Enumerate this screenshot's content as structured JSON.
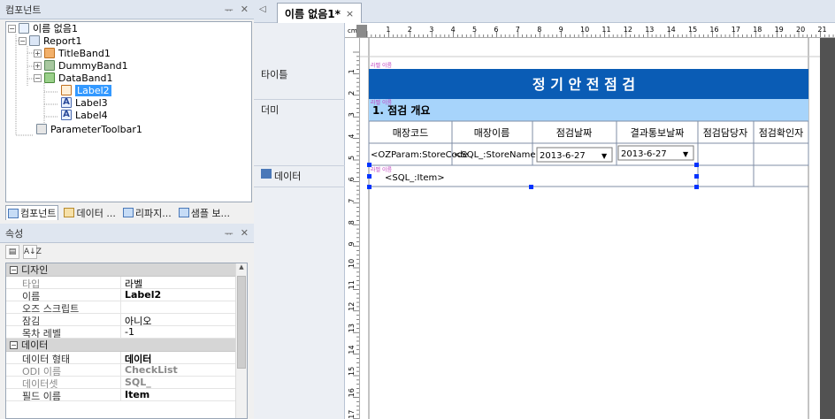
{
  "components_panel": {
    "title": "컴포넌트",
    "pin": "ᅲ",
    "close": "✕",
    "tree": [
      {
        "label": "이름 없음1",
        "depth": 0,
        "icon": "form-icon",
        "toggle": "-"
      },
      {
        "label": "Report1",
        "depth": 1,
        "icon": "report-icon",
        "toggle": "-"
      },
      {
        "label": "TitleBand1",
        "depth": 2,
        "icon": "title-band-icon",
        "toggle": "+"
      },
      {
        "label": "DummyBand1",
        "depth": 2,
        "icon": "dummy-band-icon",
        "toggle": "+"
      },
      {
        "label": "DataBand1",
        "depth": 2,
        "icon": "data-band-icon",
        "toggle": "-"
      },
      {
        "label": "Label2",
        "depth": 3,
        "icon": "label-icon",
        "toggle": "",
        "selected": true
      },
      {
        "label": "Label3",
        "depth": 3,
        "icon": "label-icon",
        "toggle": ""
      },
      {
        "label": "Label4",
        "depth": 3,
        "icon": "label-icon",
        "toggle": ""
      },
      {
        "label": "ParameterToolbar1",
        "depth": 1,
        "icon": "parameter-toolbar-icon",
        "toggle": ""
      }
    ],
    "tabs": [
      "컴포넌트",
      "데이터 ...",
      "리파지...",
      "샘플 보..."
    ]
  },
  "properties_panel": {
    "title": "속성",
    "sort_button": "A↓Z",
    "categories": [
      {
        "name": "디자인",
        "rows": [
          {
            "key": "타입",
            "value": "라벨",
            "gray": true
          },
          {
            "key": "이름",
            "value": "Label2",
            "bold": true
          },
          {
            "key": "오즈 스크립트",
            "value": ""
          },
          {
            "key": "잠김",
            "value": "아니오"
          },
          {
            "key": "목차 레벨",
            "value": "-1"
          }
        ]
      },
      {
        "name": "데이터",
        "rows": [
          {
            "key": "데이터 형태",
            "value": "데이터",
            "bold": true
          },
          {
            "key": "ODI 이름",
            "value": "CheckList",
            "gray": true,
            "bold": true
          },
          {
            "key": "데이터셋",
            "value": "SQL_",
            "gray": true,
            "bold": true
          },
          {
            "key": "필드 이름",
            "value": "Item",
            "bold": true
          }
        ]
      }
    ]
  },
  "document": {
    "tab_label": "이름 없음1*",
    "tab_close": "×",
    "ruler_unit": "cm",
    "ruler_numbers": [
      "1",
      "2",
      "3",
      "4",
      "5",
      "6",
      "7",
      "8",
      "9",
      "10",
      "11",
      "12",
      "13",
      "14",
      "15",
      "16",
      "17",
      "18",
      "19",
      "20",
      "21"
    ],
    "vruler_numbers": [
      "1",
      "2",
      "3",
      "4",
      "5",
      "6",
      "7",
      "8",
      "9",
      "10",
      "11",
      "12",
      "13",
      "14",
      "15",
      "16",
      "17"
    ],
    "bands": [
      {
        "label": "타이틀",
        "type": "title"
      },
      {
        "label": "더미",
        "type": "dummy"
      },
      {
        "label": "데이터",
        "type": "data"
      }
    ],
    "report": {
      "title": "정 기 안 전 점 검",
      "section_title": "1. 점검 개요",
      "columns": [
        "매장코드",
        "매장이름",
        "점검날짜",
        "결과통보날짜",
        "점검담당자",
        "점검확인자"
      ],
      "row": {
        "store_code": "<OZParam:StoreCode",
        "store_name": "<SQL_:StoreName>",
        "check_date": "2013-6-27",
        "notify_date": "2013-6-27",
        "owner": "",
        "confirmer": ""
      },
      "data_item": "<SQL_:Item>",
      "tiny_label": "라벨 이름"
    },
    "colors": {
      "title_bg": "#0a5cb5",
      "section_bg": "#a7d4fb",
      "grid_line": "#9aa6b6",
      "handle": "#0033ff"
    }
  }
}
